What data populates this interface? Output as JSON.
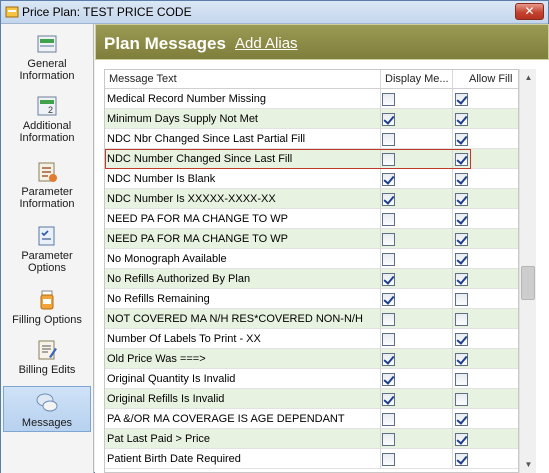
{
  "window": {
    "title": "Price Plan: TEST PRICE CODE",
    "close_symbol": "✕"
  },
  "sidebar": {
    "items": [
      {
        "label": "General\nInformation",
        "icon": "general-info-icon",
        "active": false
      },
      {
        "label": "Additional\nInformation",
        "icon": "additional-info-icon",
        "active": false
      },
      {
        "label": "Parameter\nInformation",
        "icon": "parameter-info-icon",
        "active": false
      },
      {
        "label": "Parameter\nOptions",
        "icon": "parameter-options-icon",
        "active": false
      },
      {
        "label": "Filling Options",
        "icon": "pill-bottle-icon",
        "active": false
      },
      {
        "label": "Billing Edits",
        "icon": "billing-edits-icon",
        "active": false
      },
      {
        "label": "Messages",
        "icon": "messages-icon",
        "active": true
      }
    ]
  },
  "header": {
    "title": "Plan Messages",
    "link": "Add Alias"
  },
  "grid": {
    "columns": [
      "Message Text",
      "Display Me...",
      "Allow Fill"
    ],
    "rows": [
      {
        "text": "Medical Record Number Missing",
        "display": false,
        "allow": true
      },
      {
        "text": "Minimum Days Supply Not Met",
        "display": true,
        "allow": true
      },
      {
        "text": "NDC Nbr Changed Since Last Partial Fill",
        "display": false,
        "allow": true
      },
      {
        "text": "NDC Number Changed Since Last Fill",
        "display": false,
        "allow": true,
        "selected": true
      },
      {
        "text": "NDC Number Is Blank",
        "display": true,
        "allow": true
      },
      {
        "text": "NDC Number Is XXXXX-XXXX-XX",
        "display": true,
        "allow": true
      },
      {
        "text": "NEED PA FOR MA CHANGE TO WP",
        "display": false,
        "allow": true
      },
      {
        "text": "NEED PA FOR MA CHANGE TO WP",
        "display": false,
        "allow": true
      },
      {
        "text": "No Monograph Available",
        "display": false,
        "allow": true
      },
      {
        "text": "No Refills Authorized By Plan",
        "display": true,
        "allow": true
      },
      {
        "text": "No Refills Remaining",
        "display": true,
        "allow": false
      },
      {
        "text": "NOT COVERED MA N/H RES*COVERED NON-N/H",
        "display": false,
        "allow": false
      },
      {
        "text": "Number Of Labels To Print - XX",
        "display": false,
        "allow": true
      },
      {
        "text": "Old Price Was ===>",
        "display": true,
        "allow": true
      },
      {
        "text": "Original Quantity Is Invalid",
        "display": true,
        "allow": false
      },
      {
        "text": "Original Refills Is Invalid",
        "display": true,
        "allow": false
      },
      {
        "text": "PA &/OR MA COVERAGE IS AGE DEPENDANT",
        "display": false,
        "allow": true
      },
      {
        "text": "Pat Last Paid > Price",
        "display": false,
        "allow": true
      },
      {
        "text": "Patient Birth Date Required",
        "display": false,
        "allow": true
      }
    ]
  },
  "scrollbar": {
    "up": "▲",
    "down": "▼"
  }
}
